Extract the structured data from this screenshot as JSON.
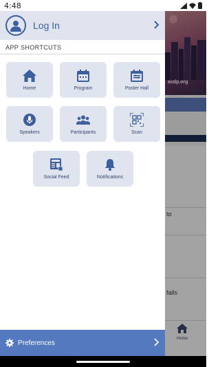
{
  "status_bar": {
    "time": "4:48",
    "icons": [
      "signal-icon",
      "wifi-icon",
      "battery-icon"
    ]
  },
  "background": {
    "banner_text": "asdp.org",
    "card_snippets": [
      "to",
      "falls"
    ],
    "bottom_nav": {
      "home_label": "Home"
    }
  },
  "drawer": {
    "login": {
      "label": "Log In",
      "icon": "user-circle-icon"
    },
    "shortcuts_title": "APP SHORTCUTS",
    "shortcuts": [
      {
        "label": "Home",
        "icon": "home-icon"
      },
      {
        "label": "Program",
        "icon": "calendar-icon"
      },
      {
        "label": "Poster Hall",
        "icon": "poster-calendar-icon"
      },
      {
        "label": "Speakers",
        "icon": "microphone-icon"
      },
      {
        "label": "Participants",
        "icon": "people-icon"
      },
      {
        "label": "Scan",
        "icon": "qr-scan-icon"
      },
      {
        "label": "Social Feed",
        "icon": "social-feed-icon"
      },
      {
        "label": "Notifications",
        "icon": "bell-icon"
      }
    ],
    "preferences": {
      "label": "Preferences",
      "icon": "gear-icon"
    }
  },
  "colors": {
    "accent": "#3d5f9e",
    "tile_bg": "#dfe4ef",
    "preferences_bg": "#5479be"
  }
}
